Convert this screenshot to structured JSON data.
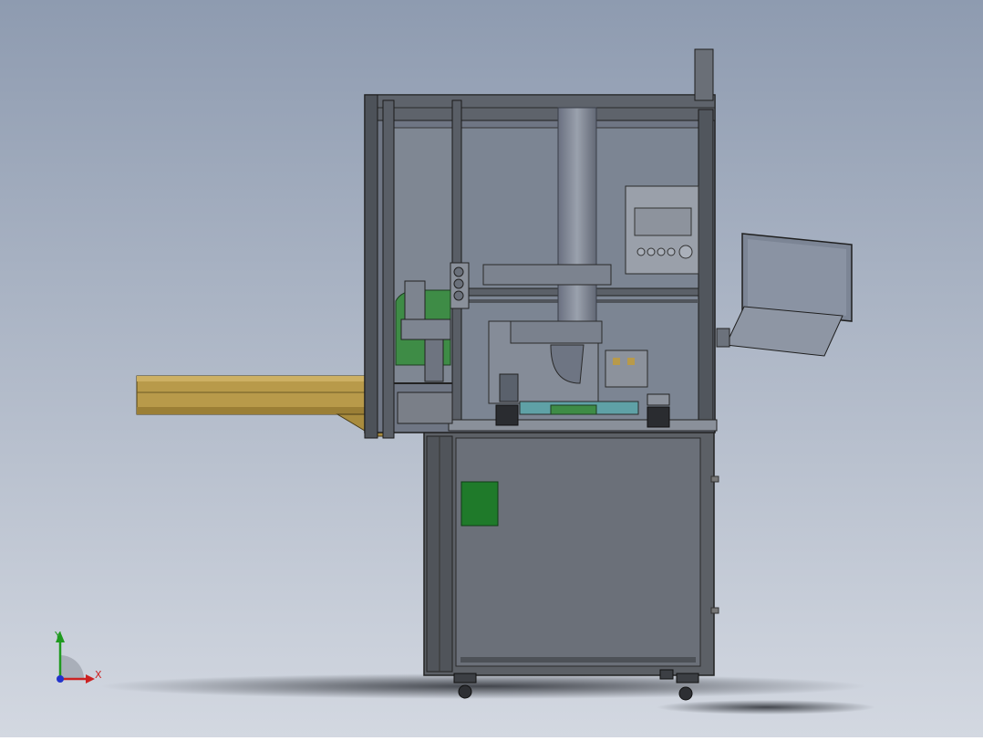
{
  "viewport": {
    "background_top": "#8e9bb0",
    "background_bottom": "#d3d8e1"
  },
  "triad": {
    "y_label": "Y",
    "x_label": "X",
    "y_color": "#1f9a1f",
    "x_color": "#cc2222",
    "z_color": "#2233cc"
  },
  "machine": {
    "frame_color": "#5c6066",
    "panel_color": "#6b7079",
    "glass_color": "#808894",
    "conveyor_color": "#b89a4a",
    "green_part_color": "#1f7a2a",
    "accent_green": "#3e8c46"
  }
}
